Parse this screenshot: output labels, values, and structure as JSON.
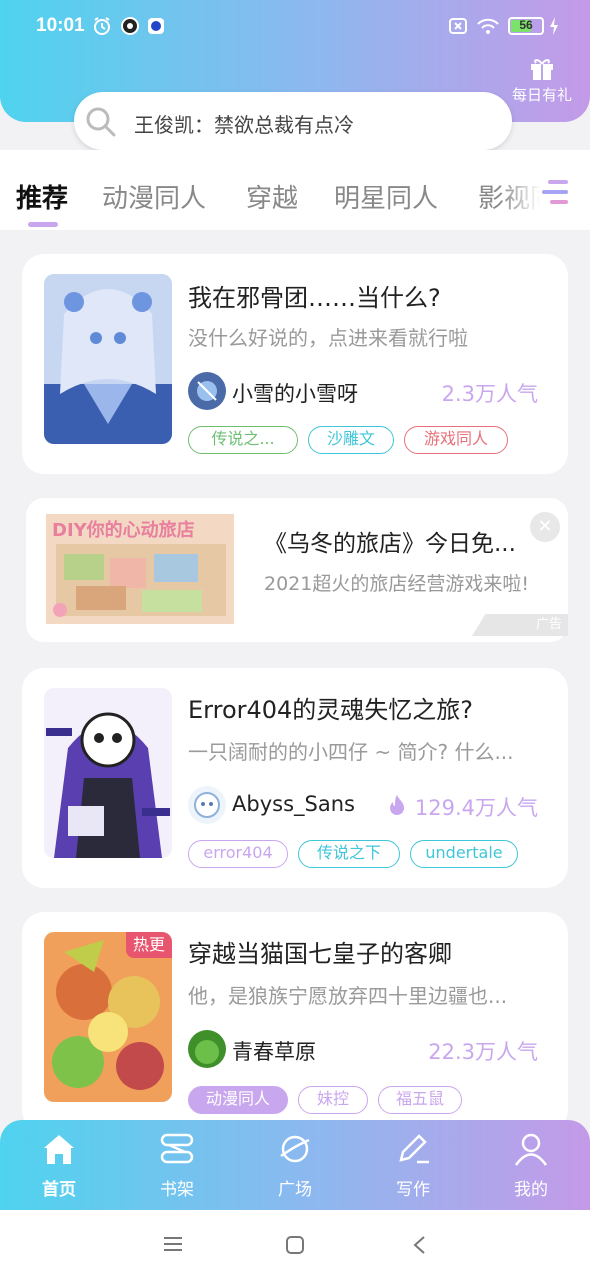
{
  "status_bar": {
    "time": "10:01",
    "battery": "56"
  },
  "header": {
    "gift_label": "每日有礼",
    "search_text": "王俊凯：禁欲总裁有点冷"
  },
  "tabs": [
    "推荐",
    "动漫同人",
    "穿越",
    "明星同人",
    "影视同人"
  ],
  "cards": [
    {
      "title": "我在邪骨团……当什么?",
      "desc": "没什么好说的，点进来看就行啦",
      "author": "小雪的小雪呀",
      "popularity": "2.3万人气",
      "tags": [
        "传说之...",
        "沙雕文",
        "游戏同人"
      ]
    },
    {
      "title": "Error404的灵魂失忆之旅?",
      "desc": "一只阔耐的的小四仔 ~ 简介? 什么...",
      "author": "Abyss_Sans",
      "popularity": "129.4万人气",
      "tags": [
        "error404",
        "传说之下",
        "undertale"
      ]
    },
    {
      "badge": "热更",
      "title": "穿越当猫国七皇子的客卿",
      "desc": "他，是狼族宁愿放弃四十里边疆也...",
      "author": "青春草原",
      "popularity": "22.3万人气",
      "tags": [
        "动漫同人",
        "妹控",
        "福五鼠"
      ]
    }
  ],
  "ad": {
    "title": "《乌冬的旅店》今日免...",
    "desc": "2021超火的旅店经营游戏来啦!",
    "label": "广告",
    "image_text": "DIY你的心动旅店"
  },
  "bottom_nav": [
    "首页",
    "书架",
    "广场",
    "写作",
    "我的"
  ],
  "colors": {
    "accent": "#c9a7ee",
    "gradient_start": "#4fd3ee",
    "gradient_end": "#c49ae8",
    "tag_green": "#6fbf73",
    "tag_cyan": "#3fc6d8",
    "tag_red": "#e8707a",
    "tag_purple": "#c9a7ee"
  }
}
